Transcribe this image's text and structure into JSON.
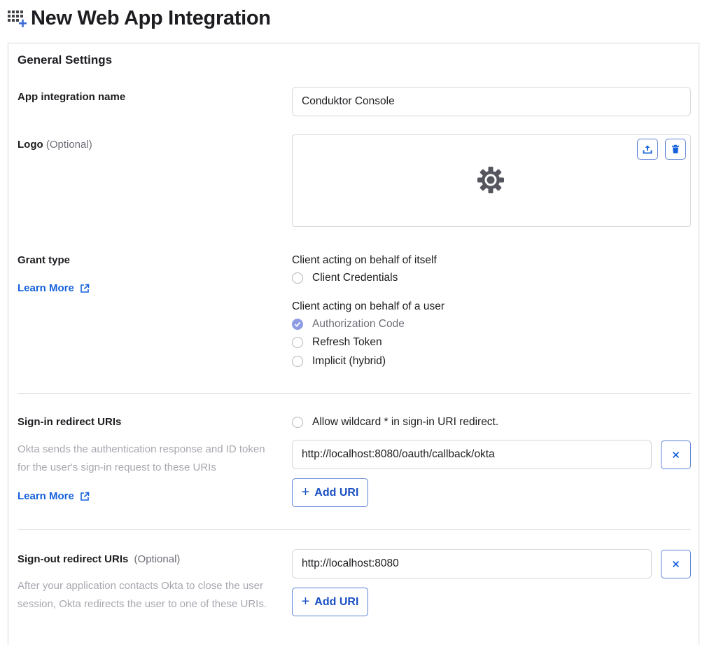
{
  "header": {
    "title": "New Web App Integration",
    "icon": "add-app-grid-icon"
  },
  "general_settings": {
    "title": "General Settings",
    "app_name": {
      "label": "App integration name",
      "value": "Conduktor Console"
    },
    "logo": {
      "label": "Logo",
      "optional": "(Optional)",
      "upload_icon": "upload-icon",
      "delete_icon": "trash-icon",
      "placeholder_icon": "gear-icon"
    },
    "grant_type": {
      "label": "Grant type",
      "learn_more": "Learn More",
      "group1_label": "Client acting on behalf of itself",
      "group1_options": [
        {
          "label": "Client Credentials",
          "checked": false
        }
      ],
      "group2_label": "Client acting on behalf of a user",
      "group2_options": [
        {
          "label": "Authorization Code",
          "checked": true,
          "disabled": true
        },
        {
          "label": "Refresh Token",
          "checked": false
        },
        {
          "label": "Implicit (hybrid)",
          "checked": false
        }
      ]
    },
    "sign_in": {
      "label": "Sign-in redirect URIs",
      "help": "Okta sends the authentication response and ID token for the user's sign-in request to these URIs",
      "learn_more": "Learn More",
      "wildcard_label": "Allow wildcard * in sign-in URI redirect.",
      "wildcard_checked": false,
      "uri": "http://localhost:8080/oauth/callback/okta",
      "add_label": "Add URI"
    },
    "sign_out": {
      "label": "Sign-out redirect URIs",
      "optional": "(Optional)",
      "help": "After your application contacts Okta to close the user session, Okta redirects the user to one of these URIs.",
      "uri": "http://localhost:8080",
      "add_label": "Add URI"
    }
  },
  "colors": {
    "link": "#1662dd",
    "button_border": "#5c82d6",
    "checked": "#8e9ce4",
    "muted": "#a7a7b0",
    "border": "#d7d7dc"
  }
}
